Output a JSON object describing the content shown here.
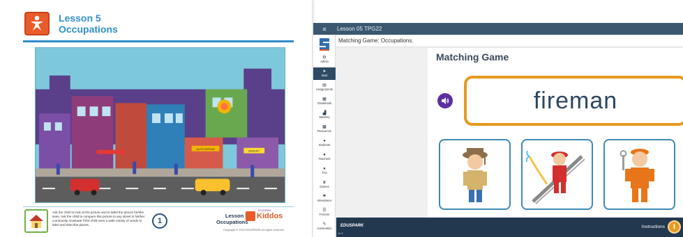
{
  "lesson_page": {
    "title_line1": "Lesson 5",
    "title_line2": "Occupations",
    "instructions": "Ask the child to look at the picture and to label the places he/she sees. Ask the child to compare this picture to any street in his/her community. Evaluate if the child uses a wide variety of words to label and describe places.",
    "page_number": "1",
    "footer_lesson": "Lesson 5",
    "footer_topic": "Occupations",
    "brand_small": "EDUSPARK",
    "brand": "Kiddos",
    "copyright": "Copyright © 2021 EDUSPARK All rights reserved.",
    "scene_signs": {
      "shop1": "AUTO REPAIR",
      "shop2": "BAKERY"
    }
  },
  "app": {
    "topbar": {
      "menu_icon": "hamburger-icon",
      "title": "Lesson 05 TPG22"
    },
    "subheader": "Matching Game: Occupations.",
    "sidebar": {
      "items": [
        {
          "label": "Admin",
          "icon": "gear-icon"
        },
        {
          "label": "Start",
          "icon": "send-icon"
        },
        {
          "label": "Assignments",
          "icon": "document-icon"
        },
        {
          "label": "Gradebook",
          "icon": "grid-icon"
        },
        {
          "label": "Mastery",
          "icon": "bar-chart-icon"
        },
        {
          "label": "Resources",
          "icon": "folder-icon"
        },
        {
          "label": "Students",
          "icon": "person-icon"
        },
        {
          "label": "Teachers",
          "icon": "person-icon"
        },
        {
          "label": "TAs",
          "icon": "person-icon"
        },
        {
          "label": "Games",
          "icon": "trophy-icon"
        },
        {
          "label": "Attendance",
          "icon": "flag-icon"
        },
        {
          "label": "Forums",
          "icon": "list-icon"
        },
        {
          "label": "Automation",
          "icon": "wrench-icon"
        }
      ]
    },
    "game": {
      "title": "Matching Game",
      "word": "fireman",
      "cards": [
        "detective",
        "fireman",
        "mechanic"
      ]
    },
    "footer": {
      "brand": "EDUSPARK",
      "version": "v5.3",
      "instructions_label": "Instructions",
      "instructions_icon": "i"
    }
  },
  "colors": {
    "accent_blue": "#2f8fcb",
    "accent_orange": "#e79a1e",
    "topbar": "#3c5870",
    "footer": "#22384f",
    "sound_button": "#5b2fa0"
  }
}
